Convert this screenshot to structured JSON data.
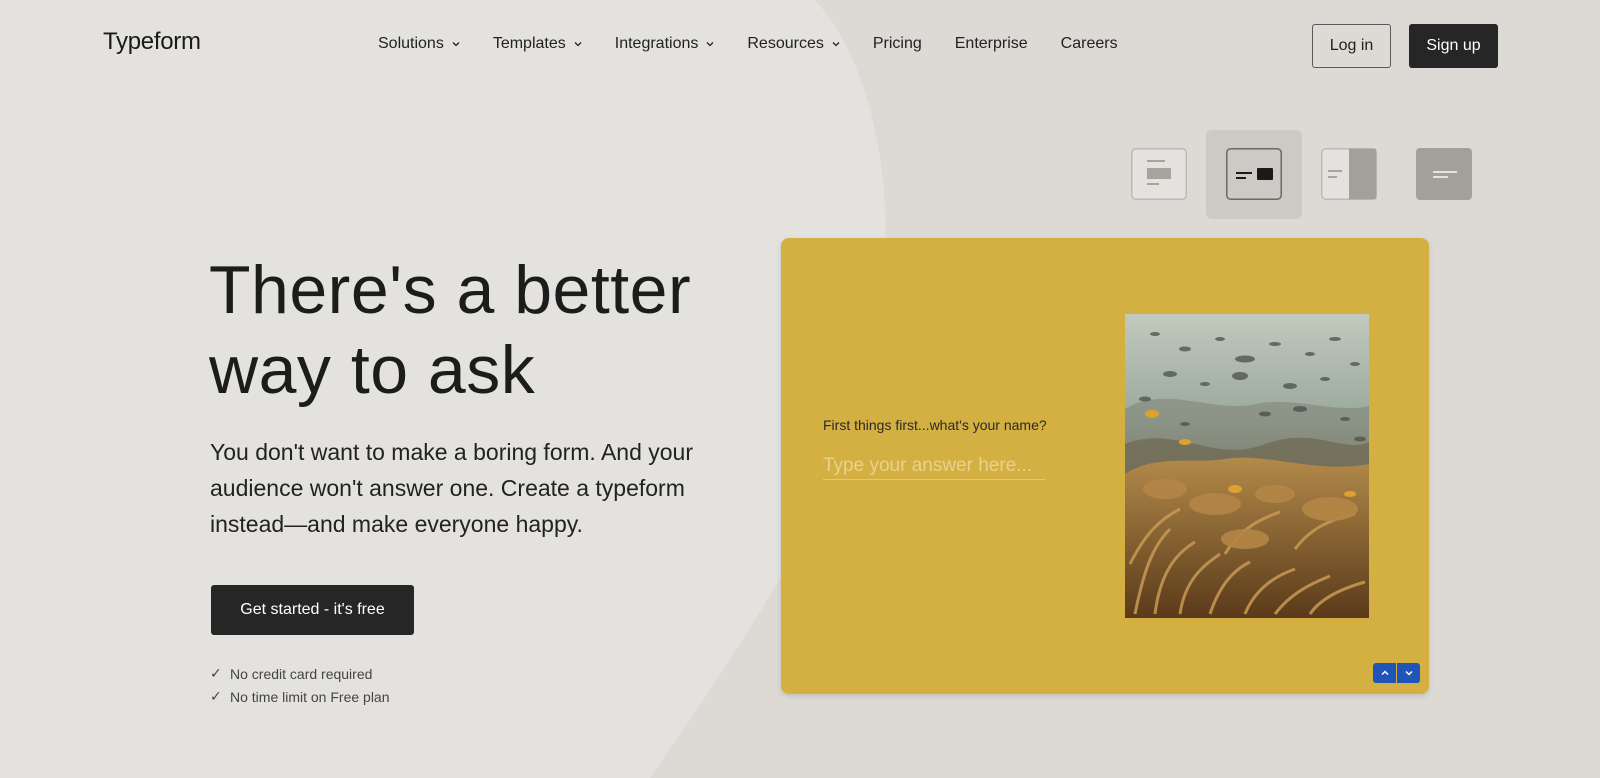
{
  "brand": {
    "logo_text": "Typeform"
  },
  "nav": {
    "items": [
      {
        "label": "Solutions",
        "has_dropdown": true
      },
      {
        "label": "Templates",
        "has_dropdown": true
      },
      {
        "label": "Integrations",
        "has_dropdown": true
      },
      {
        "label": "Resources",
        "has_dropdown": true
      },
      {
        "label": "Pricing",
        "has_dropdown": false
      },
      {
        "label": "Enterprise",
        "has_dropdown": false
      },
      {
        "label": "Careers",
        "has_dropdown": false
      }
    ],
    "login_label": "Log in",
    "signup_label": "Sign up"
  },
  "hero": {
    "title": "There's a better way to ask",
    "subtitle": "You don't want to make a boring form. And your audience won't answer one. Create a typeform instead—and make everyone happy.",
    "cta_label": "Get started - it's free",
    "checks": [
      "No credit card required",
      "No time limit on Free plan"
    ]
  },
  "layout_switcher": {
    "options": [
      "layout-stack-icon",
      "layout-split-icon",
      "layout-side-panel-icon",
      "layout-full-icon"
    ],
    "selected_index": 1
  },
  "preview": {
    "question": "First things first...what's your name?",
    "answer_placeholder": "Type your answer here...",
    "image_subject": "coral reef with fish",
    "nav_up_icon": "chevron-up-icon",
    "nav_down_icon": "chevron-down-icon"
  },
  "colors": {
    "background": "#e4e2de",
    "card": "#d4af42",
    "dark_button": "#262626",
    "nav_arrow_button": "#1f55b8"
  }
}
